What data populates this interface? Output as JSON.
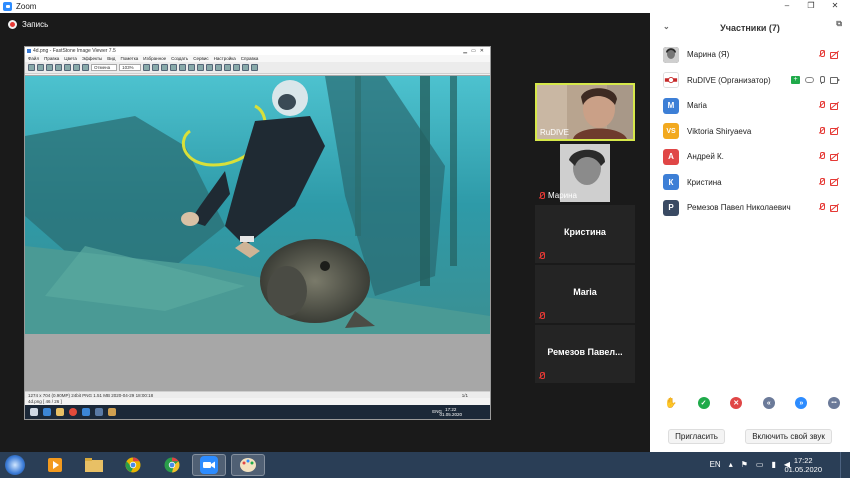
{
  "window": {
    "title": "Zoom",
    "controls": [
      "–",
      "❐",
      "✕"
    ]
  },
  "recording": {
    "label": "Запись"
  },
  "shared_screen": {
    "app_title": "4d.png - FastStone Image Viewer 7.5",
    "menu": [
      "Файл",
      "Правка",
      "Цвета",
      "Эффекты",
      "Вид",
      "Пометка",
      "Избранное",
      "Создать",
      "Сервис",
      "Настройка",
      "Справка"
    ],
    "zoom_value": "103%",
    "fit_label": "Отмена",
    "status_line": "1274 x 704 (0.90MP)  24bit  PNG   1.51 MB   2020-04-29 18:00:18",
    "status_right": "1/1",
    "file_line": "4d.png [ 46 / 26 ]",
    "inner_lang": "ENG",
    "inner_time": "17:22",
    "inner_date": "01.05.2020"
  },
  "video_tiles": [
    {
      "label": "RuDIVE",
      "active": true,
      "muted": false
    },
    {
      "label": "Марина",
      "active": false,
      "muted": true
    },
    {
      "name": "Кристина",
      "muted": true
    },
    {
      "name": "Maria",
      "muted": true
    },
    {
      "name": "Ремезов  Павел...",
      "muted": true
    }
  ],
  "participants_panel": {
    "title": "Участники (7)",
    "participants": [
      {
        "name": "Марина (Я)",
        "avatar": "photo",
        "color": "#555555",
        "mic": "off",
        "video": "off"
      },
      {
        "name": "RuDIVE (Организатор)",
        "avatar": "logo",
        "color": "#ffffff",
        "mic": "on",
        "video": "on",
        "sharing": true
      },
      {
        "name": "Maria",
        "initial": "M",
        "color": "#3d7fd6",
        "mic": "off",
        "video": "off"
      },
      {
        "name": "Viktoria Shiryaeva",
        "initial": "VS",
        "color": "#f2a91f",
        "mic": "off",
        "video": "off"
      },
      {
        "name": "Андрей К.",
        "initial": "А",
        "color": "#e04646",
        "mic": "off",
        "video": "off"
      },
      {
        "name": "Кристина",
        "initial": "К",
        "color": "#3d7fd6",
        "mic": "off",
        "video": "off"
      },
      {
        "name": "Ремезов Павел Николаевич",
        "initial": "Р",
        "color": "#3a4a63",
        "mic": "off",
        "video": "off"
      }
    ],
    "reactions": [
      {
        "icon": "raise-hand-icon",
        "glyph": "✋",
        "color": "#2d8cff"
      },
      {
        "icon": "yes-icon",
        "glyph": "✓",
        "color": "#1faa4a"
      },
      {
        "icon": "no-icon",
        "glyph": "✕",
        "color": "#e04646"
      },
      {
        "icon": "go-slower-icon",
        "glyph": "«",
        "color": "#6b7a99"
      },
      {
        "icon": "go-faster-icon",
        "glyph": "»",
        "color": "#2d8cff"
      },
      {
        "icon": "more-icon",
        "glyph": "•••",
        "color": "#6b7a99"
      }
    ],
    "invite_label": "Пригласить",
    "unmute_label": "Включить свой звук"
  },
  "taskbar": {
    "apps": [
      "media-player-icon",
      "file-explorer-icon",
      "chrome-icon",
      "chrome-icon",
      "zoom-icon",
      "paint-icon"
    ],
    "lang": "EN",
    "time": "17:22",
    "date": "01.05.2020"
  }
}
